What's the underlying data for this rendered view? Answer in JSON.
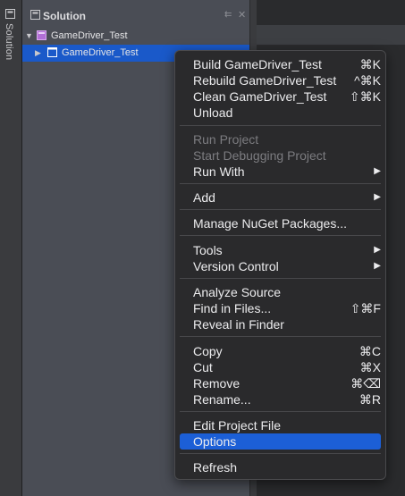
{
  "sidebar_strip": {
    "label": "Solution"
  },
  "solution_pane": {
    "title": "Solution",
    "tree": {
      "solution": {
        "label": "GameDriver_Test"
      },
      "project": {
        "label": "GameDriver_Test"
      }
    }
  },
  "context_menu": {
    "groups": [
      [
        {
          "label": "Build GameDriver_Test",
          "shortcut": "⌘K"
        },
        {
          "label": "Rebuild GameDriver_Test",
          "shortcut": "^⌘K"
        },
        {
          "label": "Clean GameDriver_Test",
          "shortcut": "⇧⌘K"
        },
        {
          "label": "Unload",
          "shortcut": ""
        }
      ],
      [
        {
          "label": "Run Project",
          "disabled": true
        },
        {
          "label": "Start Debugging Project",
          "disabled": true
        },
        {
          "label": "Run With",
          "submenu": true
        }
      ],
      [
        {
          "label": "Add",
          "submenu": true
        }
      ],
      [
        {
          "label": "Manage NuGet Packages..."
        }
      ],
      [
        {
          "label": "Tools",
          "submenu": true
        },
        {
          "label": "Version Control",
          "submenu": true
        }
      ],
      [
        {
          "label": "Analyze Source"
        },
        {
          "label": "Find in Files...",
          "shortcut": "⇧⌘F"
        },
        {
          "label": "Reveal in Finder"
        }
      ],
      [
        {
          "label": "Copy",
          "shortcut": "⌘C"
        },
        {
          "label": "Cut",
          "shortcut": "⌘X"
        },
        {
          "label": "Remove",
          "shortcut": "⌘⌫"
        },
        {
          "label": "Rename...",
          "shortcut": "⌘R"
        }
      ],
      [
        {
          "label": "Edit Project File"
        },
        {
          "label": "Options",
          "selected": true
        }
      ],
      [
        {
          "label": "Refresh"
        }
      ]
    ]
  },
  "colors": {
    "pane_bg": "#4a4d55",
    "selection": "#1a59c9",
    "menu_bg": "#2a2a2c",
    "menu_highlight": "#1c5fd6"
  }
}
